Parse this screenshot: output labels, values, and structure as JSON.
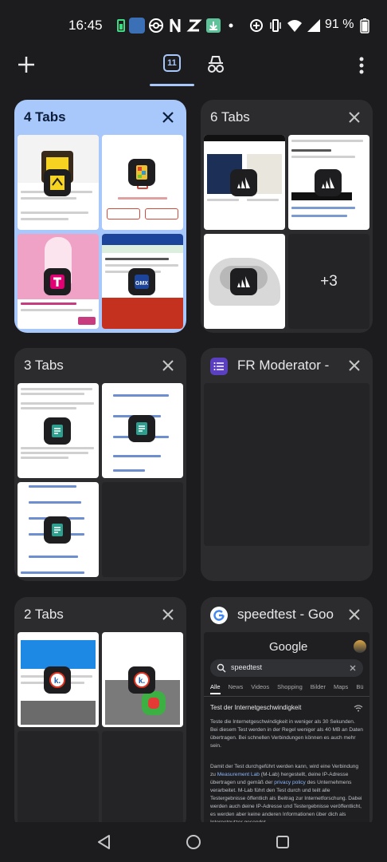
{
  "status_bar": {
    "time": "16:45",
    "battery": "91 %"
  },
  "toolbar": {
    "tab_count": "11"
  },
  "groups": [
    {
      "title": "4 Tabs"
    },
    {
      "title": "6 Tabs",
      "more": "+3"
    },
    {
      "title": "3 Tabs"
    },
    {
      "title": "FR Moderator -"
    },
    {
      "title": "2 Tabs"
    },
    {
      "title": "speedtest - Goo"
    }
  ],
  "google_preview": {
    "logo": "Google",
    "query": "speedtest",
    "tabs": [
      "Alle",
      "News",
      "Videos",
      "Shopping",
      "Bilder",
      "Maps",
      "Bü"
    ],
    "heading": "Test der Internetgeschwindigkeit",
    "para1": "Teste die Internetgeschwindigkeit in weniger als 30 Sekunden. Bei diesem Test werden in der Regel weniger als 40 MB an Daten übertragen. Bei schnellen Verbindungen können es auch mehr sein.",
    "para2_a": "Damit der Test durchgeführt werden kann, wird eine Verbindung zu ",
    "para2_link1": "Measurement Lab",
    "para2_b": " (M-Lab) hergestellt, deine IP-Adresse übertragen und gemäß der ",
    "para2_link2": "privacy policy",
    "para2_c": " des Unternehmens verarbeitet. M-Lab führt den Test durch und teilt alle Testergebnisse öffentlich als Beitrag zur Internetforschung. Dabei werden auch deine IP-Adresse und Testergebnisse veröffentlicht, es werden aber keine anderen Informationen über dich als Internetnutzer gesendet."
  },
  "colors": {
    "background": "#1c1c1e",
    "card": "#2c2c2e",
    "selected_card": "#a8c7fa",
    "accent": "#a8c7fa"
  },
  "icons": [
    "plus-icon",
    "tabs-icon",
    "incognito-icon",
    "more-vert-icon",
    "close-icon",
    "back-icon",
    "home-icon",
    "recents-icon"
  ]
}
